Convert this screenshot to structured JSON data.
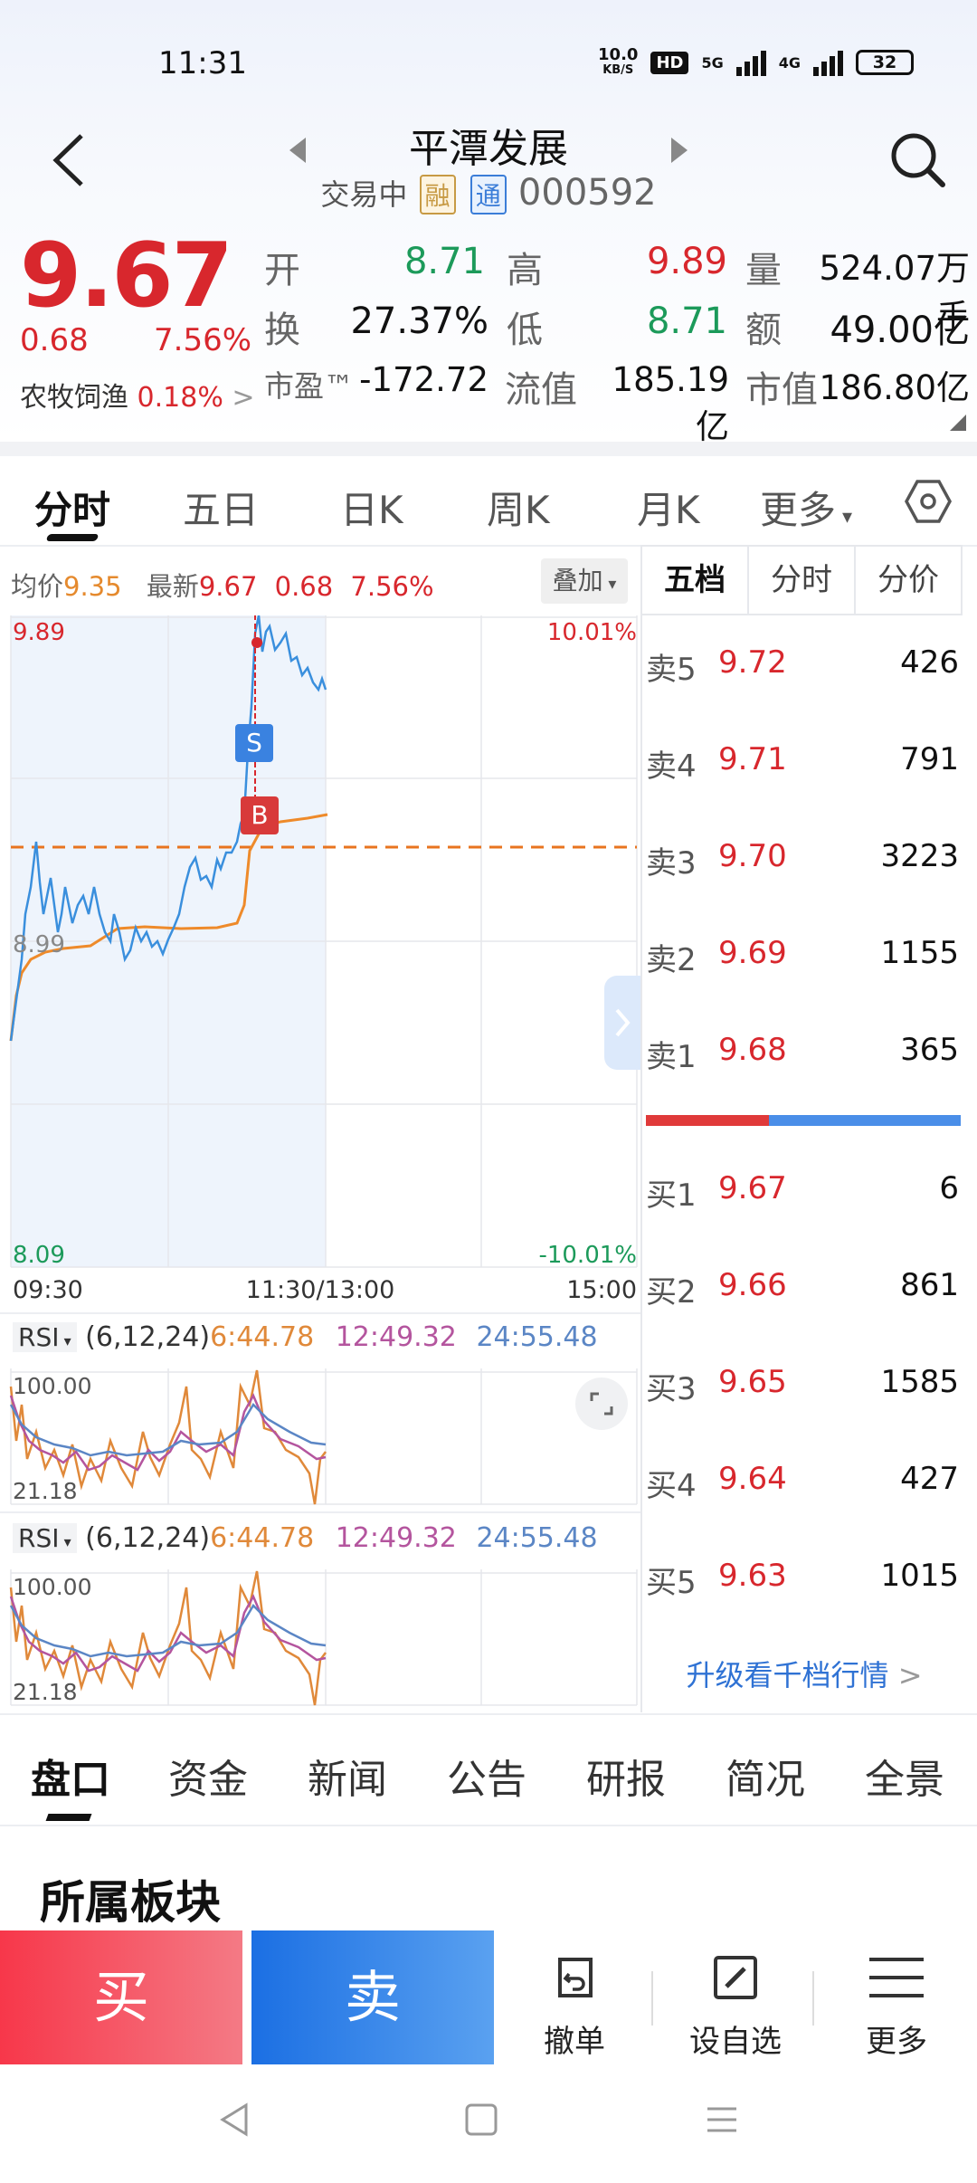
{
  "status": {
    "time": "11:31",
    "speed_top": "10.0",
    "speed_unit": "KB/S",
    "hd": "HD",
    "net1": "5G",
    "net2": "4G",
    "battery": "32"
  },
  "header": {
    "title": "平潭发展",
    "state": "交易中",
    "tag_rong": "融",
    "tag_tong": "通",
    "code": "000592"
  },
  "quote": {
    "price": "9.67",
    "change": "0.68",
    "change_pct": "7.56%",
    "sector_name": "农牧饲渔",
    "sector_pct": "0.18%",
    "open_label": "开",
    "open": "8.71",
    "high_label": "高",
    "high": "9.89",
    "volume_label": "量",
    "volume": "524.07万手",
    "turnover_label": "换",
    "turnover": "27.37%",
    "low_label": "低",
    "low": "8.71",
    "amount_label": "额",
    "amount": "49.00亿",
    "pe_label": "市盈™",
    "pe": "-172.72",
    "float_label": "流值",
    "float_cap": "185.19亿",
    "mcap_label": "市值",
    "mcap": "186.80亿"
  },
  "chart_tabs": [
    "分时",
    "五日",
    "日K",
    "周K",
    "月K",
    "更多"
  ],
  "chart_info": {
    "avg_label": "均价",
    "avg": "9.35",
    "last_label": "最新",
    "last": "9.67",
    "chg": "0.68",
    "chg_pct": "7.56%",
    "overlay": "叠加",
    "y_top": "9.89",
    "y_mid": "8.99",
    "y_bot": "8.09",
    "pct_top": "10.01%",
    "pct_bot": "-10.01%",
    "t_start": "09:30",
    "t_mid": "11:30/13:00",
    "t_end": "15:00",
    "marker_s": "S",
    "marker_b": "B"
  },
  "orderbook": {
    "tabs": [
      "五档",
      "分时",
      "分价"
    ],
    "asks": [
      {
        "label": "卖5",
        "price": "9.72",
        "vol": "426"
      },
      {
        "label": "卖4",
        "price": "9.71",
        "vol": "791"
      },
      {
        "label": "卖3",
        "price": "9.70",
        "vol": "3223"
      },
      {
        "label": "卖2",
        "price": "9.69",
        "vol": "1155"
      },
      {
        "label": "卖1",
        "price": "9.68",
        "vol": "365"
      }
    ],
    "bids": [
      {
        "label": "买1",
        "price": "9.67",
        "vol": "6"
      },
      {
        "label": "买2",
        "price": "9.66",
        "vol": "861"
      },
      {
        "label": "买3",
        "price": "9.65",
        "vol": "1585"
      },
      {
        "label": "买4",
        "price": "9.64",
        "vol": "427"
      },
      {
        "label": "买5",
        "price": "9.63",
        "vol": "1015"
      }
    ],
    "upgrade": "升级看千档行情"
  },
  "rsi": {
    "name": "RSI",
    "params": "(6,12,24)",
    "v6": "6:44.78",
    "v12": "12:49.32",
    "v24": "24:55.48",
    "top": "100.00",
    "bot": "21.18"
  },
  "colors": {
    "up": "#d8272d",
    "down": "#1c9a5a",
    "price_line": "#3a8fdd",
    "avg_line": "#ee8a2a",
    "rsi6": "#e0893a",
    "rsi12": "#b4559e",
    "rsi24": "#5b86c5"
  },
  "bottom_tabs": [
    "盘口",
    "资金",
    "新闻",
    "公告",
    "研报",
    "简况",
    "全景"
  ],
  "section_title": "所属板块",
  "actions": {
    "buy": "买",
    "sell": "卖",
    "cancel": "撤单",
    "watch": "设自选",
    "more": "更多"
  }
}
